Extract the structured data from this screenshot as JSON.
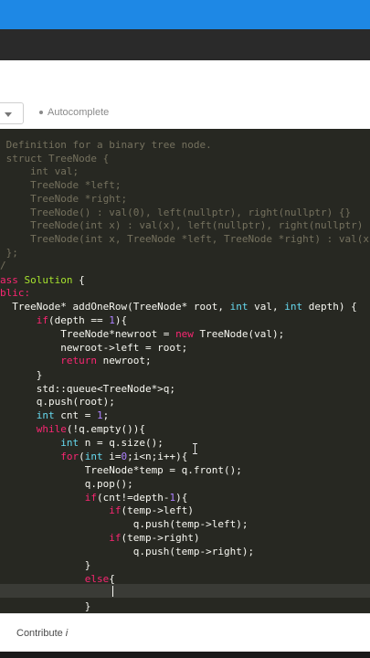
{
  "toolbar": {
    "autocomplete_label": "Autocomplete"
  },
  "editor": {
    "lines": {
      "l1": " Definition for a binary tree node.",
      "l2": " struct TreeNode {",
      "l3": "     int val;",
      "l4": "     TreeNode *left;",
      "l5": "     TreeNode *right;",
      "l6": "     TreeNode() : val(0), left(nullptr), right(nullptr) {}",
      "l7": "     TreeNode(int x) : val(x), left(nullptr), right(nullptr) {}",
      "l8": "     TreeNode(int x, TreeNode *left, TreeNode *right) : val(x), left(left), right(right) {}",
      "l9": " };",
      "l10": "/",
      "l11a": "ass ",
      "l11b": "Solution",
      "l11c": " {",
      "l12": "blic:",
      "l13a": "  TreeNode* addOneRow(TreeNode* root, ",
      "l13b": "int",
      "l13c": " val, ",
      "l13d": "int",
      "l13e": " depth) {",
      "l14a": "      ",
      "l14b": "if",
      "l14c": "(depth == ",
      "l14d": "1",
      "l14e": "){",
      "l15a": "          TreeNode*newroot = ",
      "l15b": "new",
      "l15c": " TreeNode(val);",
      "l16": "          newroot->left = root;",
      "l17a": "          ",
      "l17b": "return",
      "l17c": " newroot;",
      "l18": "      }",
      "l19": "      std::queue<TreeNode*>q;",
      "l20": "      q.push(root);",
      "l21a": "      ",
      "l21b": "int",
      "l21c": " cnt = ",
      "l21d": "1",
      "l21e": ";",
      "l22a": "      ",
      "l22b": "while",
      "l22c": "(!q.empty()){",
      "l23a": "          ",
      "l23b": "int",
      "l23c": " n = q.size();",
      "l24a": "          ",
      "l24b": "for",
      "l24c": "(",
      "l24d": "int",
      "l24e": " i=",
      "l24f": "0",
      "l24g": ";i<n;i++){",
      "l25": "              TreeNode*temp = q.front();",
      "l26": "              q.pop();",
      "l27a": "              ",
      "l27b": "if",
      "l27c": "(cnt!=depth-",
      "l27d": "1",
      "l27e": "){",
      "l28a": "                  ",
      "l28b": "if",
      "l28c": "(temp->left)",
      "l29": "                      q.push(temp->left);",
      "l30a": "                  ",
      "l30b": "if",
      "l30c": "(temp->right)",
      "l31": "                      q.push(temp->right);",
      "l32": "              }",
      "l33a": "              ",
      "l33b": "else",
      "l33c": "{",
      "l35": "              }"
    }
  },
  "footer": {
    "contribute_label": "Contribute",
    "info_glyph": "i"
  },
  "colors": {
    "accent_blue": "#1e88e5",
    "editor_bg": "#272822",
    "keyword": "#f92672",
    "type": "#66d9ef",
    "number": "#ae81ff",
    "class_name": "#a6e22e",
    "comment": "#75715e"
  }
}
